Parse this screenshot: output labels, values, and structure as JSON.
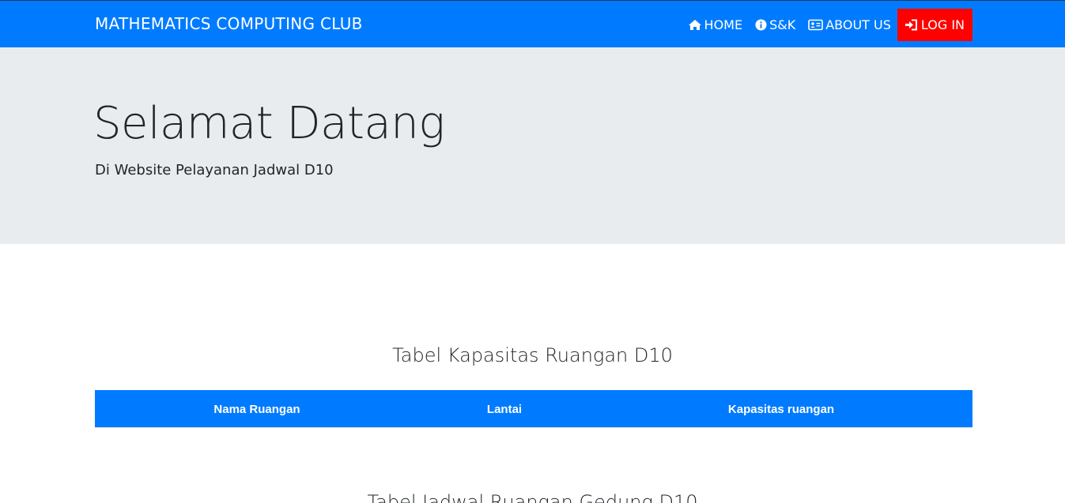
{
  "navbar": {
    "brand": "MATHEMATICS COMPUTING CLUB",
    "links": [
      {
        "label": "HOME",
        "icon": "home-icon"
      },
      {
        "label": "S&K",
        "icon": "info-circle-icon"
      },
      {
        "label": "ABOUT US",
        "icon": "id-card-icon"
      },
      {
        "label": "LOG IN",
        "icon": "sign-in-icon"
      }
    ]
  },
  "hero": {
    "title": "Selamat Datang",
    "subtitle": "Di Website Pelayanan Jadwal D10"
  },
  "capacity_table": {
    "title": "Tabel Kapasitas Ruangan D10",
    "columns": [
      "Nama Ruangan",
      "Lantai",
      "Kapasitas ruangan"
    ]
  },
  "schedule_table": {
    "title": "Tabel Jadwal Ruangan Gedung D10"
  },
  "colors": {
    "primary": "#007bff",
    "login": "#ff0000",
    "jumbotron": "#e9ecef"
  }
}
